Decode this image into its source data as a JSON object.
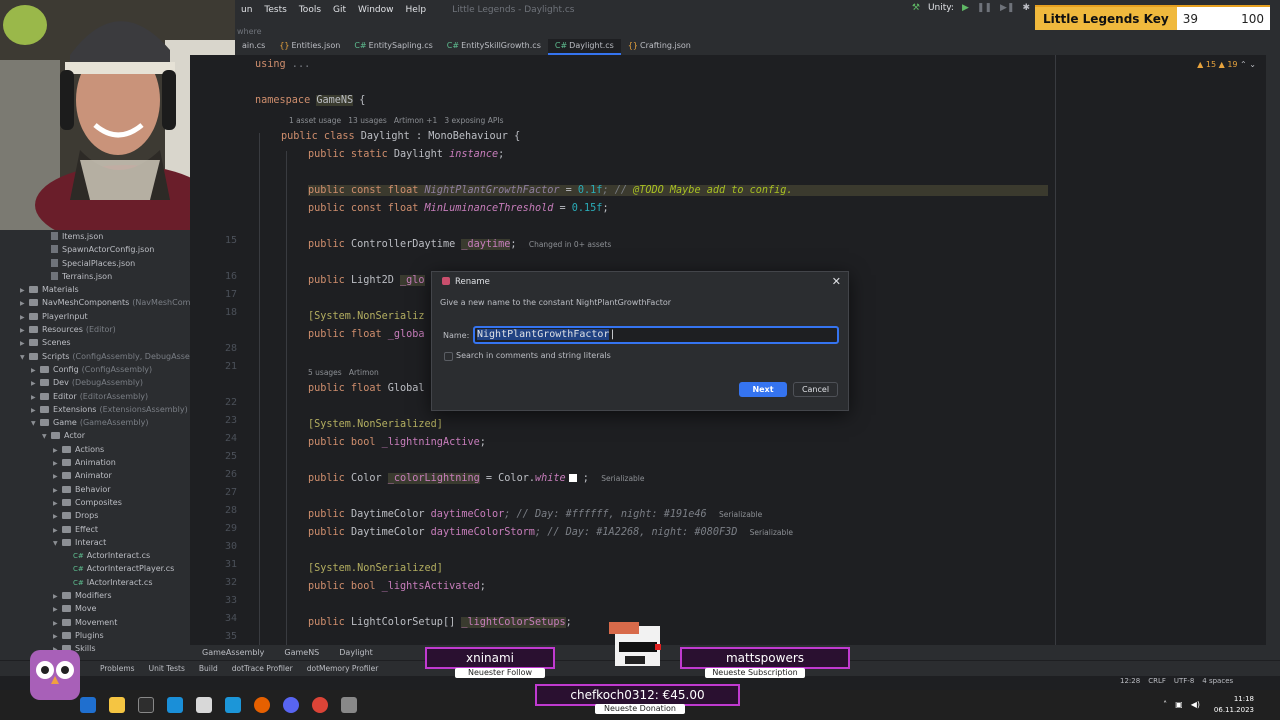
{
  "menu": {
    "items": [
      "un",
      "Tests",
      "Tools",
      "Git",
      "Window",
      "Help"
    ],
    "window_title": "Little Legends - Daylight.cs"
  },
  "toolbar_top": {
    "unity_label": "Unity:",
    "search_hint": "where"
  },
  "tabs": [
    {
      "label": "ain.cs",
      "type": "cs"
    },
    {
      "label": "Entities.json",
      "type": "json"
    },
    {
      "label": "EntitySapling.cs",
      "type": "cs"
    },
    {
      "label": "EntitySkillGrowth.cs",
      "type": "cs"
    },
    {
      "label": "Daylight.cs",
      "type": "cs",
      "active": true
    },
    {
      "label": "Crafting.json",
      "type": "json"
    }
  ],
  "inspections": {
    "warnings": "15",
    "weak": "19"
  },
  "tree": [
    {
      "label": "Items.json",
      "kind": "file",
      "depth": 4
    },
    {
      "label": "SpawnActorConfig.json",
      "kind": "file",
      "depth": 4
    },
    {
      "label": "SpecialPlaces.json",
      "kind": "file",
      "depth": 4
    },
    {
      "label": "Terrains.json",
      "kind": "file",
      "depth": 4
    },
    {
      "label": "Materials",
      "kind": "folder",
      "depth": 2
    },
    {
      "label": "NavMeshComponents",
      "extra": "(NavMeshCom",
      "kind": "folder",
      "depth": 2
    },
    {
      "label": "PlayerInput",
      "kind": "folder",
      "depth": 2
    },
    {
      "label": "Resources",
      "extra": "(Editor)",
      "kind": "folder",
      "depth": 2
    },
    {
      "label": "Scenes",
      "kind": "folder",
      "depth": 2
    },
    {
      "label": "Scripts",
      "extra": "(ConfigAssembly, DebugAsse",
      "kind": "folder",
      "depth": 2,
      "open": true
    },
    {
      "label": "Config",
      "extra": "(ConfigAssembly)",
      "kind": "folder",
      "depth": 3
    },
    {
      "label": "Dev",
      "extra": "(DebugAssembly)",
      "kind": "folder",
      "depth": 3
    },
    {
      "label": "Editor",
      "extra": "(EditorAssembly)",
      "kind": "folder",
      "depth": 3
    },
    {
      "label": "Extensions",
      "extra": "(ExtensionsAssembly)",
      "kind": "folder",
      "depth": 3
    },
    {
      "label": "Game",
      "extra": "(GameAssembly)",
      "kind": "folder",
      "depth": 3,
      "open": true
    },
    {
      "label": "Actor",
      "kind": "folder",
      "depth": 4,
      "open": true
    },
    {
      "label": "Actions",
      "kind": "folder",
      "depth": 5
    },
    {
      "label": "Animation",
      "kind": "folder",
      "depth": 5
    },
    {
      "label": "Animator",
      "kind": "folder",
      "depth": 5
    },
    {
      "label": "Behavior",
      "kind": "folder",
      "depth": 5
    },
    {
      "label": "Composites",
      "kind": "folder",
      "depth": 5
    },
    {
      "label": "Drops",
      "kind": "folder",
      "depth": 5
    },
    {
      "label": "Effect",
      "kind": "folder",
      "depth": 5
    },
    {
      "label": "Interact",
      "kind": "folder",
      "depth": 5,
      "open": true
    },
    {
      "label": "ActorInteract.cs",
      "kind": "cs",
      "depth": 6
    },
    {
      "label": "ActorInteractPlayer.cs",
      "kind": "cs",
      "depth": 6
    },
    {
      "label": "IActorInteract.cs",
      "kind": "cs",
      "depth": 6
    },
    {
      "label": "Modifiers",
      "kind": "folder",
      "depth": 5
    },
    {
      "label": "Move",
      "kind": "folder",
      "depth": 5
    },
    {
      "label": "Movement",
      "kind": "folder",
      "depth": 5
    },
    {
      "label": "Plugins",
      "kind": "folder",
      "depth": 5
    },
    {
      "label": "Skills",
      "kind": "folder",
      "depth": 5
    }
  ],
  "line_numbers": [
    {
      "n": "15",
      "row": 10
    },
    {
      "n": "16",
      "row": 12
    },
    {
      "n": "17",
      "row": 13
    },
    {
      "n": "18",
      "row": 14
    },
    {
      "n": "28",
      "row": 16
    },
    {
      "n": "21",
      "row": 17
    },
    {
      "n": "22",
      "row": 19
    },
    {
      "n": "23",
      "row": 20
    },
    {
      "n": "24",
      "row": 21
    },
    {
      "n": "25",
      "row": 22
    },
    {
      "n": "26",
      "row": 23
    },
    {
      "n": "27",
      "row": 24
    },
    {
      "n": "28",
      "row": 25
    },
    {
      "n": "29",
      "row": 26
    },
    {
      "n": "30",
      "row": 27
    },
    {
      "n": "31",
      "row": 28
    },
    {
      "n": "32",
      "row": 29
    },
    {
      "n": "33",
      "row": 30
    },
    {
      "n": "34",
      "row": 31
    },
    {
      "n": "35",
      "row": 32
    },
    {
      "n": "36",
      "row": 33
    }
  ],
  "code": {
    "l_using_kw": "using",
    "l_using_rest": " ...",
    "l_ns_kw": "namespace",
    "l_ns_name": "GameNS",
    "l_ns_brace": " {",
    "hint_class": "1 asset usage   13 usages   Artimon +1   3 exposing APIs",
    "l_class_a": "public class",
    "l_class_b": " Daylight : MonoBehaviour {",
    "l_inst_a": "public static",
    "l_inst_b": " Daylight ",
    "l_inst_c": "instance",
    "l_inst_d": ";",
    "l_npgf_a": "public const float ",
    "l_npgf_b": "NightPlantGrowthFactor",
    "l_npgf_c": " = ",
    "l_npgf_d": "0.1f",
    "l_npgf_e": "; // ",
    "l_npgf_f": "@TODO Maybe add to config.",
    "l_mlt_a": "public const float ",
    "l_mlt_b": "MinLuminanceThreshold",
    "l_mlt_c": " = ",
    "l_mlt_d": "0.15f",
    "l_mlt_e": ";",
    "l_dt_a": "public ",
    "l_dt_b": "ControllerDaytime ",
    "l_dt_c": "_daytime",
    "l_dt_d": ";",
    "hint_dt": "Changed in 0+ assets",
    "l_l2d_a": "public ",
    "l_l2d_b": "Light2D ",
    "l_l2d_c": "_glo",
    "l_ns1": "[System.NonSerializ",
    "l_fg_a": "public float ",
    "l_fg_b": "_globa",
    "hint_usages": "5 usages   Artimon",
    "l_fG_a": "public float ",
    "l_fG_b": "Global",
    "l_ns2": "[System.NonSerialized]",
    "l_la_a": "public bool ",
    "l_la_b": "_lightningActive",
    "l_la_c": ";",
    "l_cl_a": "public ",
    "l_cl_b": "Color ",
    "l_cl_c": "_colorLightning",
    "l_cl_d": " = Color.",
    "l_cl_e": "white",
    "l_cl_f": " ;",
    "hint_ser": "Serializable",
    "l_dc_a": "public ",
    "l_dc_b": "DaytimeColor ",
    "l_dc_c": "daytimeColor",
    "l_dc_d": "; // Day: #ffffff, night: #191e46",
    "l_dcs_a": "public ",
    "l_dcs_b": "DaytimeColor ",
    "l_dcs_c": "daytimeColorStorm",
    "l_dcs_d": "; // Day: #1A2268, night: #080F3D",
    "l_ns3": "[System.NonSerialized]",
    "l_lact_a": "public bool ",
    "l_lact_b": "_lightsActivated",
    "l_lact_c": ";",
    "l_lcs_a": "public ",
    "l_lcs_b": "LightColorSetup[] ",
    "l_lcs_c": "_lightColorSetups",
    "l_lcs_d": ";"
  },
  "dialog": {
    "title": "Rename",
    "description": "Give a new name to the constant NightPlantGrowthFactor",
    "name_label": "Name:",
    "name_value": "NightPlantGrowthFactor",
    "checkbox_label": "Search in comments and string literals",
    "next": "Next",
    "cancel": "Cancel"
  },
  "navbar": [
    "GameAssembly",
    "GameNS",
    "Daylight"
  ],
  "bottom_tools": [
    "Problems",
    "Unit Tests",
    "Build",
    "dotTrace Profiler",
    "dotMemory Profiler"
  ],
  "status": [
    "12:28",
    "CRLF",
    "UTF-8",
    "4 spaces"
  ],
  "clock": {
    "time": "11:18",
    "date": "06.11.2023"
  },
  "overlay": {
    "key_label": "Little Legends Key",
    "key_value": "39",
    "key_total": "100",
    "follower_name": "xninami",
    "follower_caption": "Neuester Follow",
    "sub_name": "mattspowers",
    "sub_caption": "Neueste Subscription",
    "donation_text": "chefkoch0312: €45.00",
    "donation_caption": "Neueste Donation"
  }
}
